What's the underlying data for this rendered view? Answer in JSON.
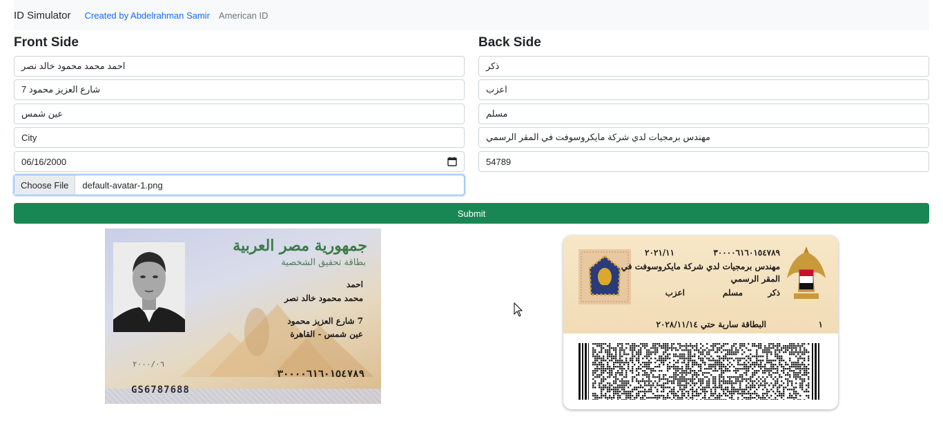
{
  "navbar": {
    "brand": "ID Simulator",
    "link_author": "Created by Abdelrahman Samir",
    "link_american": "American ID"
  },
  "front": {
    "title": "Front Side",
    "first_name": "احمد محمد محمود خالد نصر",
    "address": "شارع العزيز محمود 7",
    "district": "عين شمس",
    "city": "City",
    "birth_date": "06/16/2000",
    "file_button": "Choose File",
    "file_name": "default-avatar-1.png"
  },
  "back": {
    "title": "Back Side",
    "gender": "ذكر",
    "marital": "اعزب",
    "religion": "مسلم",
    "job": "مهندس برمجيات لدي شركة مايكروسوفت في المقر الرسمي",
    "code": "54789"
  },
  "submit_label": "Submit",
  "front_card": {
    "header": "جمهورية مصر العربية",
    "subheader": "بطاقة تحقيق الشخصية",
    "name_line1": "احمد",
    "name_line2": "محمد محمود خالد نصر",
    "addr_line1": "7 شارع العزيز محمود",
    "addr_line2": "عين شمس - القاهرة",
    "id_number": "٣٠٠٠٠٦١٦٠١٥٤٧٨٩",
    "birth": "٢٠٠٠/٠٦",
    "serial": "GS6787688"
  },
  "back_card": {
    "issue_date": "٢٠٢١/١١",
    "id_number": "٣٠٠٠٠٦١٦٠١٥٤٧٨٩",
    "job_line1": "مهندس برمجيات لدي شركة مايكروسوفت في",
    "job_line2": "المقر الرسمي",
    "gender": "ذكر",
    "religion": "مسلم",
    "marital": "اعزب",
    "validity": "البطاقة سارية حتي  ٢٠٢٨/١١/١٤",
    "index": "١"
  }
}
